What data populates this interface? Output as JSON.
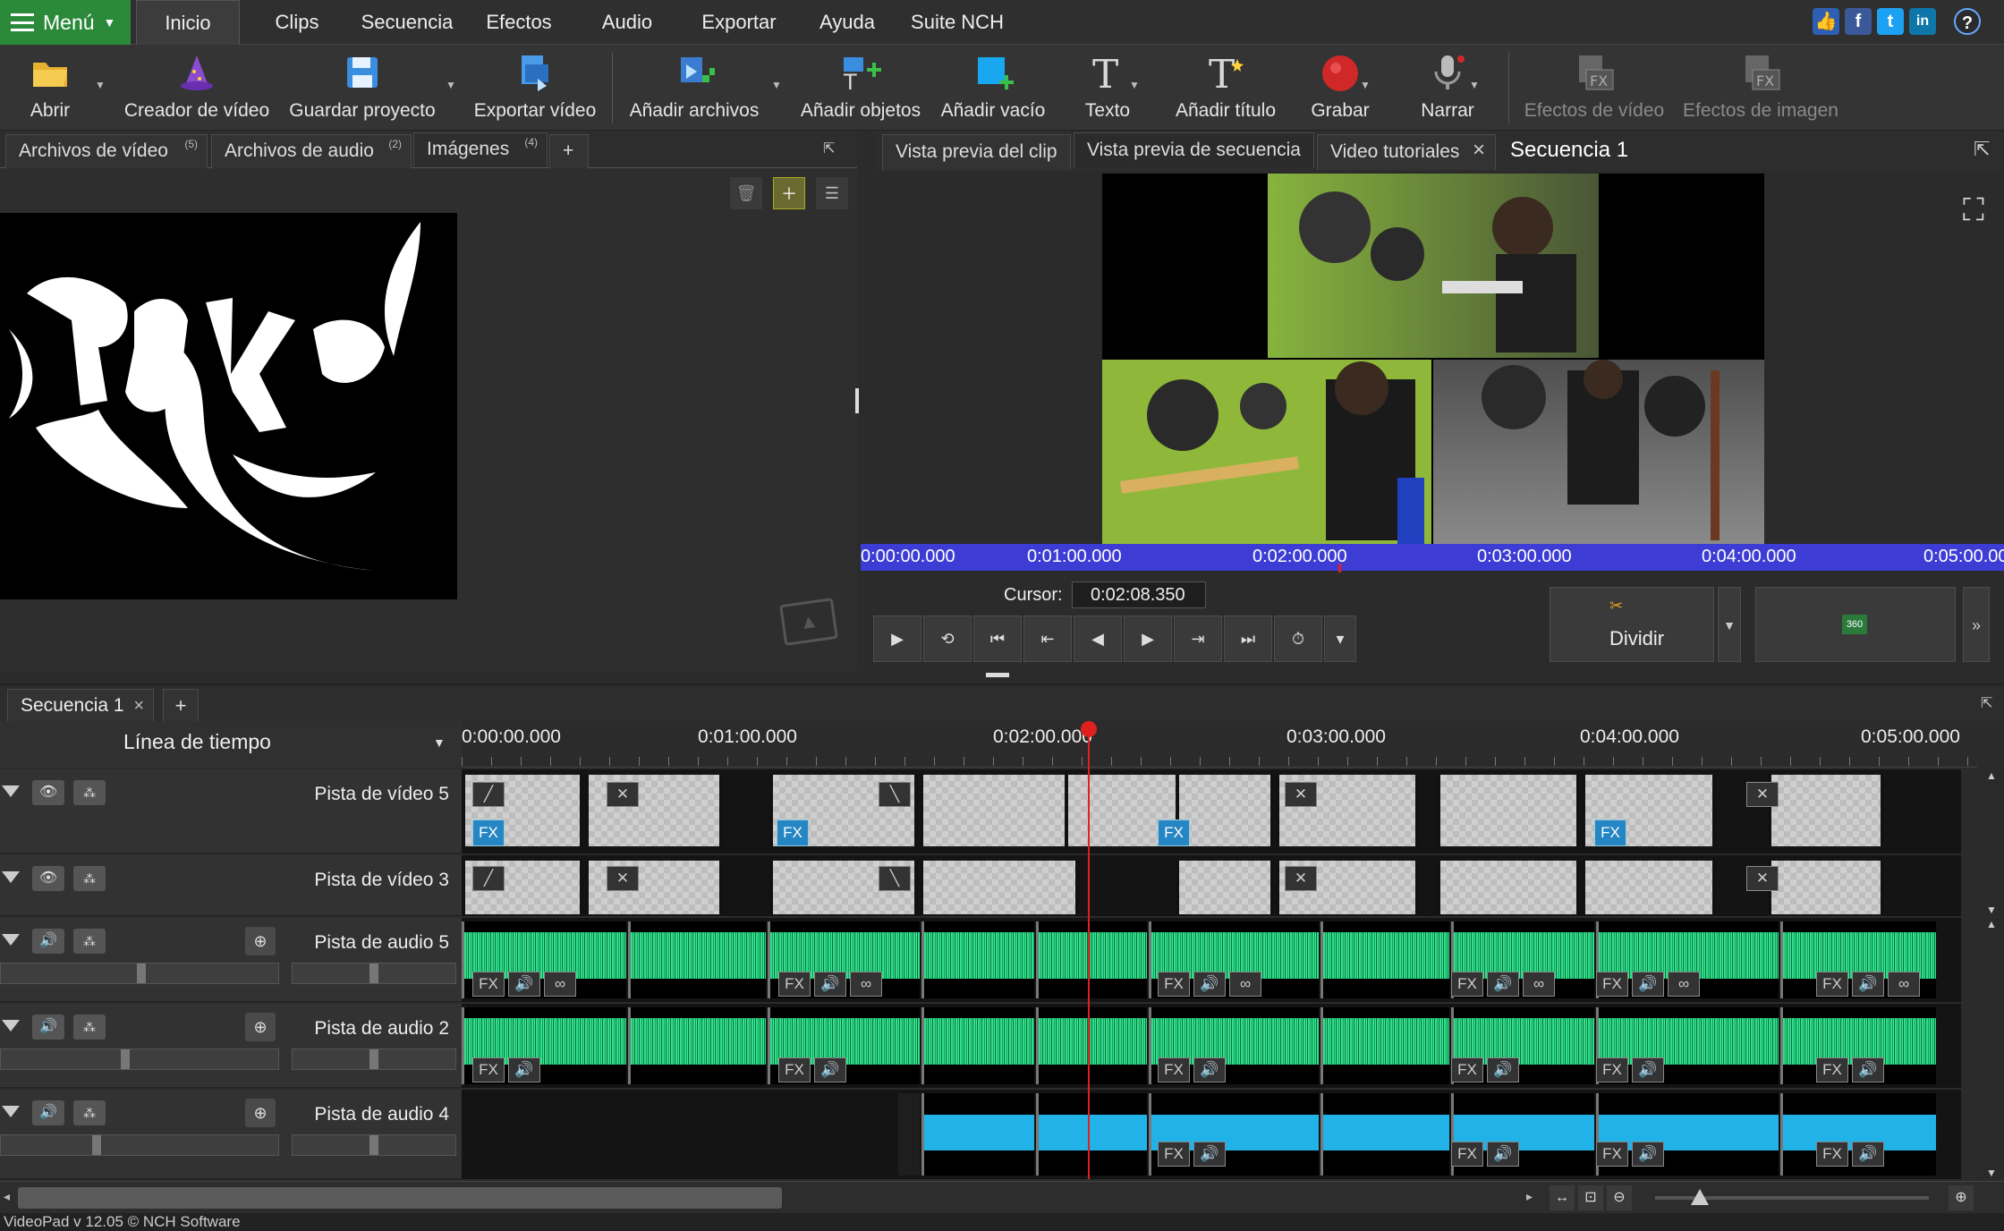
{
  "menubar": {
    "menu_label": "Menú",
    "tabs": [
      "Inicio",
      "Clips",
      "Secuencia",
      "Efectos",
      "Audio",
      "Exportar",
      "Ayuda",
      "Suite NCH"
    ],
    "help": "?"
  },
  "toolbar": {
    "abrir": "Abrir",
    "creador": "Creador de vídeo",
    "guardar": "Guardar proyecto",
    "exportar": "Exportar vídeo",
    "anadir_archivos": "Añadir archivos",
    "anadir_objetos": "Añadir objetos",
    "anadir_vacio": "Añadir vacío",
    "texto": "Texto",
    "anadir_titulo": "Añadir título",
    "grabar": "Grabar",
    "narrar": "Narrar",
    "efectos_video": "Efectos de vídeo",
    "efectos_imagen": "Efectos de imagen"
  },
  "media_panel": {
    "tabs": [
      {
        "label": "Archivos de vídeo",
        "count": "(5)"
      },
      {
        "label": "Archivos de audio",
        "count": "(2)"
      },
      {
        "label": "Imágenes",
        "count": "(4)"
      }
    ],
    "add": "+"
  },
  "preview": {
    "tabs": [
      "Vista previa del clip",
      "Vista previa de secuencia",
      "Video tutoriales"
    ],
    "close": "×",
    "sequence_title": "Secuencia 1",
    "ruler": [
      "0:00:00.000",
      "0:01:00.000",
      "0:02:00.000",
      "0:03:00.000",
      "0:04:00.000",
      "0:05:00.000"
    ],
    "cursor_label": "Cursor:",
    "cursor_value": "0:02:08.350",
    "split_label": "Dividir",
    "badge_360": "360",
    "more": "»"
  },
  "timeline": {
    "seq_tab": "Secuencia 1",
    "seq_close": "×",
    "add": "+",
    "header": "Línea de tiempo",
    "ruler": [
      "0:00:00.000",
      "0:01:00.000",
      "0:02:00.000",
      "0:03:00.000",
      "0:04:00.000",
      "0:05:00.000"
    ],
    "tracks": {
      "v5": "Pista de vídeo 5",
      "v3": "Pista de vídeo 3",
      "a5": "Pista de audio 5",
      "a2": "Pista de audio 2",
      "a4": "Pista de audio 4"
    },
    "fx": "FX"
  },
  "status": "VideoPad v 12.05 © NCH Software",
  "colors": {
    "accent_green": "#2a8a3a",
    "ruler_blue": "#3d3dd6",
    "wave_green": "#2fe08a",
    "audio_blue": "#21b2e8",
    "playhead": "#e02020"
  }
}
